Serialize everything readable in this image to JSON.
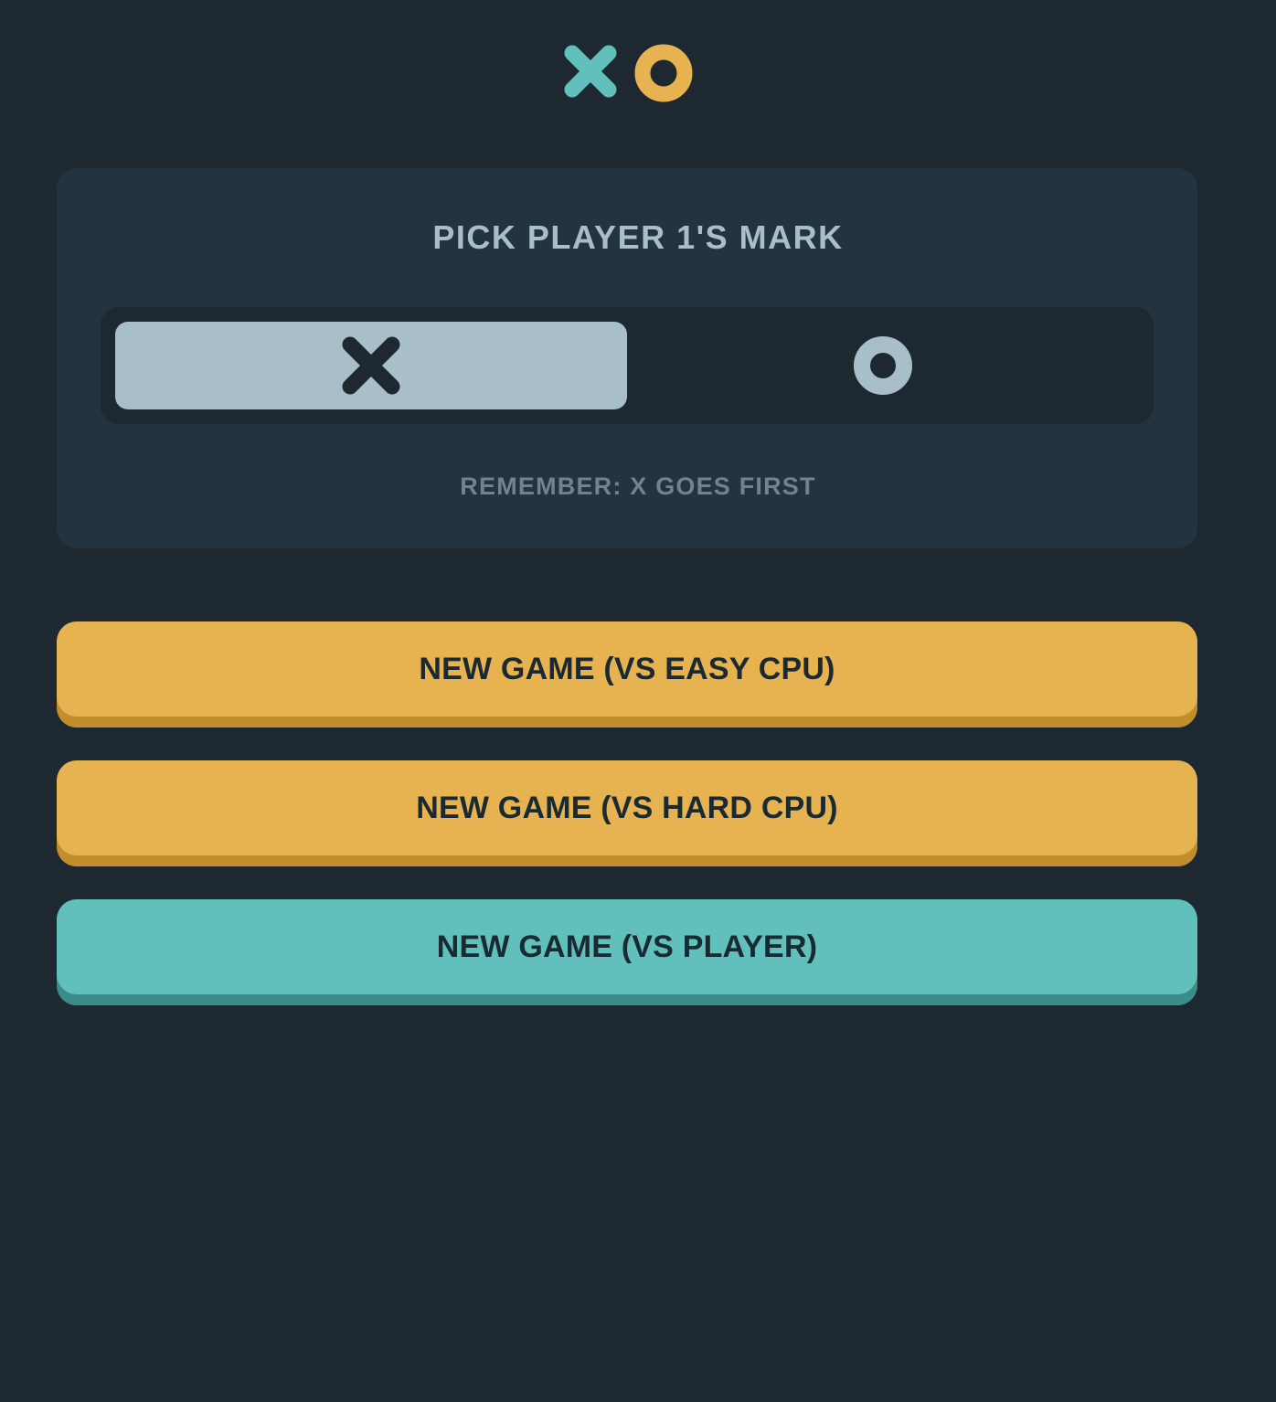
{
  "logo": {
    "x_icon": "x-mark-icon",
    "o_icon": "o-mark-icon",
    "x_color": "#61c0bb",
    "o_color": "#e7b350"
  },
  "mark_picker": {
    "title": "PICK PLAYER 1'S MARK",
    "options": [
      {
        "icon": "x-mark-icon",
        "selected": true
      },
      {
        "icon": "o-mark-icon",
        "selected": false
      }
    ],
    "hint": "REMEMBER: X GOES FIRST"
  },
  "buttons": {
    "easy_cpu": "NEW GAME (VS EASY CPU)",
    "hard_cpu": "NEW GAME (VS HARD CPU)",
    "player": "NEW GAME (VS PLAYER)"
  },
  "colors": {
    "background": "#1e2830",
    "panel": "#233440",
    "silver": "#a8bfc9",
    "yellow": "#e7b350",
    "teal": "#61c0bb"
  }
}
